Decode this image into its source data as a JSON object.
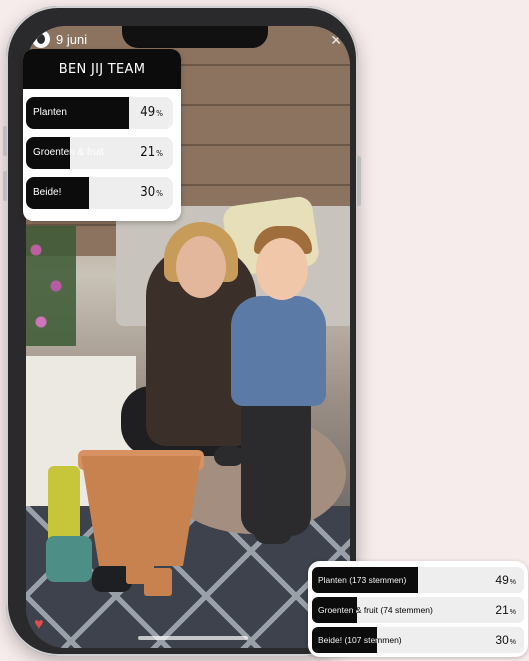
{
  "story": {
    "date": "9 juni"
  },
  "poll": {
    "title": "BEN JIJ TEAM",
    "options": [
      {
        "label": "Planten",
        "percent": 49
      },
      {
        "label": "Groenten & fruit",
        "percent": 21
      },
      {
        "label": "Beide!",
        "percent": 30
      }
    ],
    "percent_sign": "%"
  },
  "results": {
    "rows": [
      {
        "label": "Planten (173 stemmen)",
        "percent": 49
      },
      {
        "label": "Groenten & fruit (74 stemmen)",
        "percent": 21
      },
      {
        "label": "Beide! (107 stemmen)",
        "percent": 30
      }
    ],
    "percent_sign": "%"
  },
  "icons": {
    "avatar": "profile-avatar-icon",
    "close": "close-icon",
    "like": "heart-icon"
  },
  "colors": {
    "poll_fill": "#0c0c0c",
    "poll_track": "#eeeeee",
    "background": "#f7ecec"
  }
}
